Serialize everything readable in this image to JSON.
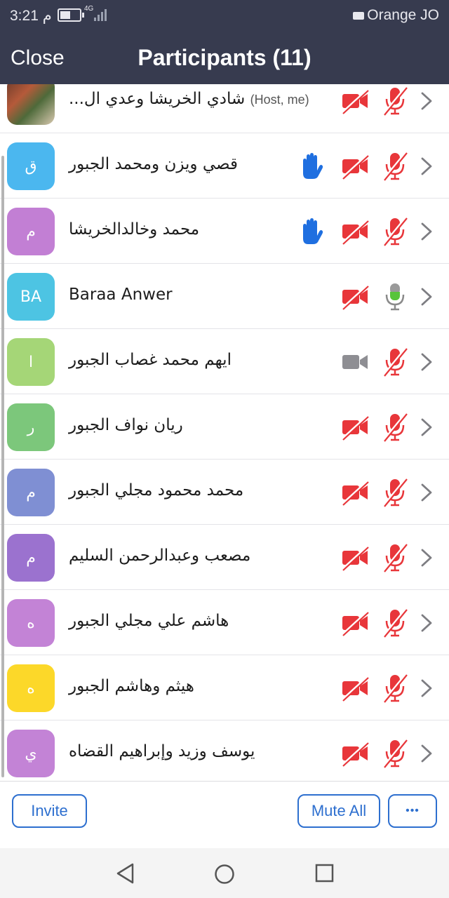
{
  "status_bar": {
    "time": "3:21 م",
    "network": "4G",
    "carrier": "Orange JO",
    "battery_fraction": 0.55
  },
  "header": {
    "close_label": "Close",
    "title": "Participants (11)"
  },
  "participants": [
    {
      "name": "شادي الخريشا وعدي ال...",
      "tag": "(Host, me)",
      "avatar_text": "",
      "avatar_color": "#8a5a44",
      "photo": true,
      "hand_raised": false,
      "video": "off",
      "audio": "muted"
    },
    {
      "name": "قصي ويزن ومحمد الجبور",
      "tag": "",
      "avatar_text": "ق",
      "avatar_color": "#4bb7ef",
      "photo": false,
      "hand_raised": true,
      "video": "off",
      "audio": "muted"
    },
    {
      "name": "محمد  وخالدالخريشا",
      "tag": "",
      "avatar_text": "م",
      "avatar_color": "#c27fd4",
      "photo": false,
      "hand_raised": true,
      "video": "off",
      "audio": "muted"
    },
    {
      "name": "Baraa Anwer",
      "tag": "",
      "avatar_text": "BA",
      "avatar_color": "#4dc4e3",
      "photo": false,
      "hand_raised": false,
      "video": "off",
      "audio": "on"
    },
    {
      "name": "ايهم محمد غصاب الجبور",
      "tag": "",
      "avatar_text": "ا",
      "avatar_color": "#a5d677",
      "photo": false,
      "hand_raised": false,
      "video": "on",
      "audio": "muted"
    },
    {
      "name": "ريان نواف الجبور",
      "tag": "",
      "avatar_text": "ر",
      "avatar_color": "#7cc77b",
      "photo": false,
      "hand_raised": false,
      "video": "off",
      "audio": "muted"
    },
    {
      "name": "محمد محمود مجلي الجبور",
      "tag": "",
      "avatar_text": "م",
      "avatar_color": "#7f8fd3",
      "photo": false,
      "hand_raised": false,
      "video": "off",
      "audio": "muted"
    },
    {
      "name": "مصعب وعبدالرحمن السليم",
      "tag": "",
      "avatar_text": "م",
      "avatar_color": "#9b72cf",
      "photo": false,
      "hand_raised": false,
      "video": "off",
      "audio": "muted"
    },
    {
      "name": "هاشم علي مجلي  الجبور",
      "tag": "",
      "avatar_text": "ه",
      "avatar_color": "#c383d6",
      "photo": false,
      "hand_raised": false,
      "video": "off",
      "audio": "muted"
    },
    {
      "name": "هيثم وهاشم الجبور",
      "tag": "",
      "avatar_text": "ه",
      "avatar_color": "#fcd829",
      "photo": false,
      "hand_raised": false,
      "video": "off",
      "audio": "muted"
    },
    {
      "name": "يوسف وزيد وإبراهيم القضاه",
      "tag": "",
      "avatar_text": "ي",
      "avatar_color": "#c383d6",
      "photo": false,
      "hand_raised": false,
      "video": "off",
      "audio": "muted"
    }
  ],
  "footer": {
    "invite_label": "Invite",
    "mute_all_label": "Mute All",
    "more_label": "•••"
  },
  "colors": {
    "header_bg": "#373b4f",
    "accent": "#2d6fcf",
    "muted_red": "#e8363a",
    "audio_on_green": "#58c43a",
    "video_on_gray": "#8e8e93",
    "hand_blue": "#1f6fe0"
  }
}
